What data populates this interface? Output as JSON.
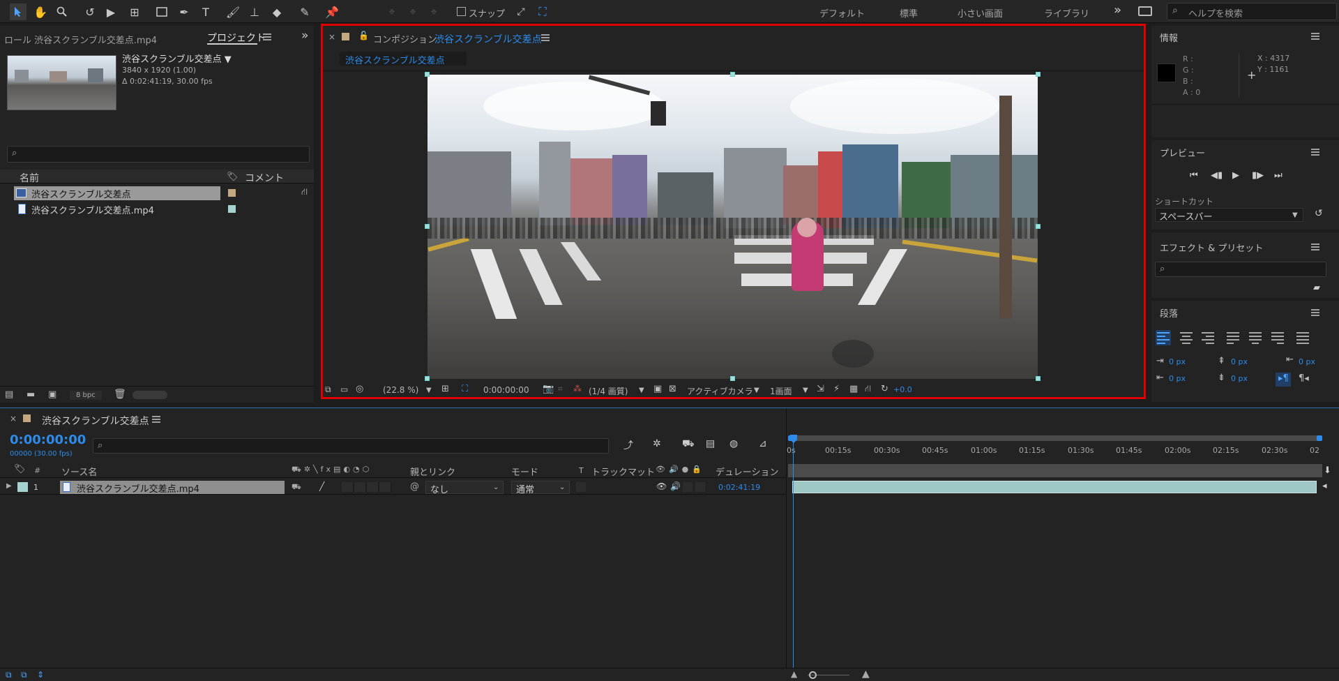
{
  "toolbar": {
    "snap_label": "スナップ",
    "workspaces": [
      "デフォルト",
      "標準",
      "小さい画面",
      "ライブラリ"
    ],
    "more": "»",
    "help_placeholder": "ヘルプを検索"
  },
  "project_panel": {
    "tab_prev": "ロール 渋谷スクランブル交差点.mp4",
    "tab_active": "プロジェクト",
    "item_title": "渋谷スクランブル交差点 ▼",
    "item_size": "3840 x 1920 (1.00)",
    "item_duration": "Δ 0:02:41:19, 30.00 fps",
    "col_name": "名前",
    "col_comment": "コメント",
    "items": [
      {
        "name": "渋谷スクランブル交差点",
        "type": "composition",
        "color": "#c3a882"
      },
      {
        "name": "渋谷スクランブル交差点.mp4",
        "type": "footage",
        "color": "#a6d3cf"
      }
    ],
    "bpc": "8 bpc"
  },
  "comp_panel": {
    "tab_prefix": "コンポジション",
    "tab_name": "渋谷スクランブル交差点",
    "breadcrumb": "渋谷スクランブル交差点",
    "zoom": "(22.8 %)",
    "timecode": "0:00:00:00",
    "quality": "(1/4 画質)",
    "camera": "アクティブカメラ",
    "views": "1画面",
    "exposure": "+0.0"
  },
  "info_panel": {
    "title": "情報",
    "r": "R :",
    "g": "G :",
    "b": "B :",
    "a": "A : 0",
    "x": "X : 4317",
    "y": "Y : 1161"
  },
  "preview_panel": {
    "title": "プレビュー",
    "shortcut_label": "ショートカット",
    "shortcut_value": "スペースバー"
  },
  "effects_panel": {
    "title": "エフェクト & プリセット"
  },
  "paragraph_panel": {
    "title": "段落",
    "indents": [
      "0 px",
      "0 px",
      "0 px",
      "0 px",
      "0 px"
    ]
  },
  "timeline": {
    "tab_name": "渋谷スクランブル交差点",
    "timecode": "0:00:00:00",
    "frames": "00000 (30.00 fps)",
    "cols": {
      "num": "#",
      "source": "ソース名",
      "parent": "親とリンク",
      "mode": "モード",
      "t": "T",
      "trackmatte": "トラックマット",
      "duration": "デュレーション"
    },
    "layer": {
      "index": "1",
      "name": "渋谷スクランブル交差点.mp4",
      "parent": "なし",
      "mode": "通常",
      "duration": "0:02:41:19"
    },
    "ruler": [
      "0s",
      "00:15s",
      "00:30s",
      "00:45s",
      "01:00s",
      "01:15s",
      "01:30s",
      "01:45s",
      "02:00s",
      "02:15s",
      "02:30s",
      "02"
    ]
  },
  "colors": {
    "accent": "#2d8ceb",
    "highlight_border": "#e00000",
    "layer_bar": "#9fc7c5"
  }
}
